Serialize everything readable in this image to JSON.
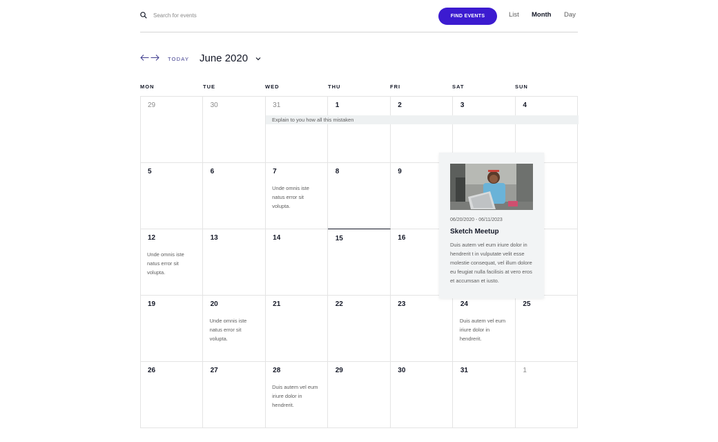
{
  "colors": {
    "accent": "#3c1bd0",
    "text": "#141827",
    "muted": "#5d5d5d",
    "border": "#e4e4e4"
  },
  "search": {
    "placeholder": "Search for events",
    "icon": "search-icon"
  },
  "toolbar": {
    "find_label": "FIND EVENTS"
  },
  "views": [
    {
      "label": "List",
      "active": false
    },
    {
      "label": "Month",
      "active": true
    },
    {
      "label": "Day",
      "active": false
    }
  ],
  "nav": {
    "today_label": "TODAY",
    "month_label": "June 2020"
  },
  "weekdays": [
    "MON",
    "TUE",
    "WED",
    "THU",
    "FRI",
    "SAT",
    "SUN"
  ],
  "weeks": [
    [
      {
        "day": "29",
        "muted": true
      },
      {
        "day": "30",
        "muted": true
      },
      {
        "day": "31",
        "muted": true
      },
      {
        "day": "1"
      },
      {
        "day": "2"
      },
      {
        "day": "3"
      },
      {
        "day": "4"
      }
    ],
    [
      {
        "day": "5"
      },
      {
        "day": "6"
      },
      {
        "day": "7",
        "event": "Unde omnis iste natus error sit volupta."
      },
      {
        "day": "8"
      },
      {
        "day": "9"
      },
      {
        "day": ""
      },
      {
        "day": ""
      }
    ],
    [
      {
        "day": "12",
        "event": "Unde omnis iste natus error sit volupta."
      },
      {
        "day": "13"
      },
      {
        "day": "14"
      },
      {
        "day": "15",
        "today": true
      },
      {
        "day": "16"
      },
      {
        "day": ""
      },
      {
        "day": ""
      }
    ],
    [
      {
        "day": "19"
      },
      {
        "day": "20",
        "event": "Unde omnis iste natus error sit volupta."
      },
      {
        "day": "21"
      },
      {
        "day": "22"
      },
      {
        "day": "23"
      },
      {
        "day": "24",
        "event": "Duis autem vel eum iriure dolor in hendrerit."
      },
      {
        "day": "25"
      }
    ],
    [
      {
        "day": "26"
      },
      {
        "day": "27"
      },
      {
        "day": "28",
        "event": "Duis autem vel eum iriure dolor in hendrerit."
      },
      {
        "day": "29"
      },
      {
        "day": "30"
      },
      {
        "day": "31"
      },
      {
        "day": "1",
        "muted": true
      }
    ]
  ],
  "multi_day_event": {
    "label": "Explain to you how all this mistaken"
  },
  "tooltip": {
    "date": "06/20/2020 - 06/11/2023",
    "title": "Sketch Meetup",
    "description": "Duis autem vel eum iriure dolor in hendrerit t in vulputate velit esse molestie consequat, vel illum dolore eu feugiat nulla facilisis at vero eros et accumsan et iusto."
  }
}
